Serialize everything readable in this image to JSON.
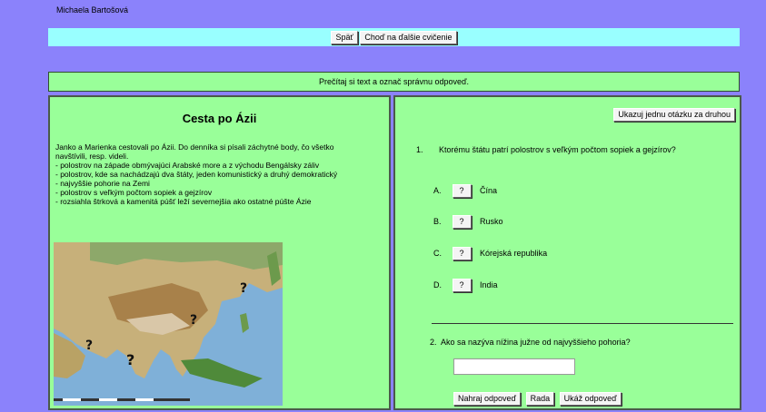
{
  "user": {
    "name": "Michaela Bartošová"
  },
  "nav": {
    "back_label": "Späť",
    "next_label": "Choď na ďalšie cvičenie"
  },
  "instruction": "Prečítaj si text a označ správnu odpoveď.",
  "story": {
    "title": "Cesta po Ázii",
    "text": "Janko a Marienka cestovali po Ázii. Do denníka si písali záchytné body, čo všetko navštívili, resp. videli.\n- polostrov na západe obmývajúci Arabské more a z východu Bengálsky záliv\n- polostrov, kde sa nachádzajú dva štáty, jeden komunistický a druhý demokratický\n- najvyššie pohorie na Zemi\n- polostrov s veľkým počtom sopiek a gejzírov\n- rozsiahla štrková a kamenitá púšť leží severnejšia ako ostatné púšte Ázie",
    "map_markers": [
      "?",
      "?",
      "?",
      "?"
    ]
  },
  "quiz": {
    "toggle_label": "Ukazuj jednu otázku za druhou",
    "q1": {
      "number": "1.",
      "text": "Ktorému štátu patrí polostrov s veľkým počtom sopiek a gejzírov?",
      "button_label": "?",
      "options": [
        {
          "letter": "A.",
          "text": "Čína"
        },
        {
          "letter": "B.",
          "text": "Rusko"
        },
        {
          "letter": "C.",
          "text": "Kórejská republika"
        },
        {
          "letter": "D.",
          "text": "India"
        }
      ]
    },
    "q2": {
      "number": "2.",
      "text": "Ako sa nazýva nížina južne od najvyššieho pohoria?",
      "input_value": "",
      "upload_label": "Nahraj odpoveď",
      "hint_label": "Rada",
      "show_label": "Ukáž odpoveď"
    }
  },
  "colors": {
    "background": "#8b82fb",
    "nav_bar": "#99ffff",
    "panel": "#99ff99"
  }
}
